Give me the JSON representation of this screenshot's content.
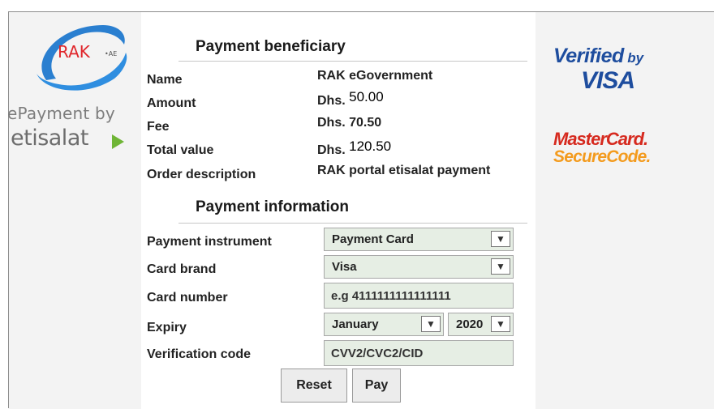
{
  "brand": {
    "rak_logo_text": "RAK",
    "rak_logo_suffix": "•AE",
    "epayment_by": "ePayment by",
    "etisalat": "etisalat"
  },
  "beneficiary": {
    "title": "Payment beneficiary",
    "rows": [
      {
        "label": "Name",
        "currency": "",
        "value": "RAK eGovernment"
      },
      {
        "label": "Amount",
        "currency": "Dhs.",
        "value": "50.00"
      },
      {
        "label": "Fee",
        "currency": "",
        "value": "Dhs. 70.50"
      },
      {
        "label": "Total value",
        "currency": "Dhs.",
        "value": "120.50"
      },
      {
        "label": "Order description",
        "currency": "",
        "value": "RAK portal etisalat payment"
      }
    ]
  },
  "payment_info": {
    "title": "Payment information",
    "instrument_label": "Payment instrument",
    "instrument_value": "Payment Card",
    "brand_label": "Card brand",
    "brand_value": "Visa",
    "card_number_label": "Card number",
    "card_number_placeholder": "e.g 4111111111111111",
    "expiry_label": "Expiry",
    "expiry_month": "January",
    "expiry_year": "2020",
    "cvv_label": "Verification code",
    "cvv_placeholder": "CVV2/CVC2/CID"
  },
  "buttons": {
    "reset": "Reset",
    "pay": "Pay"
  },
  "badges": {
    "verified_by": "Verified",
    "verified_by_word": "by",
    "visa": "VISA",
    "mastercard": "MasterCard.",
    "securecode": "SecureCode."
  },
  "colors": {
    "field_bg": "#e6eee4",
    "visa_blue": "#1e4d9e",
    "mastercard_red": "#d62a1f",
    "securecode_orange": "#f39b1e",
    "etisalat_green": "#6fb536"
  },
  "icons": {
    "dropdown": "chevron-down-icon"
  }
}
